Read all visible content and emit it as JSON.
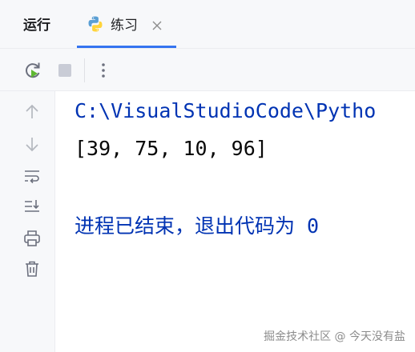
{
  "panel": {
    "title": "运行"
  },
  "tab": {
    "label": "练习",
    "icon": "python-icon",
    "close_icon": "close-icon"
  },
  "toolbar": {
    "buttons": [
      "rerun-icon",
      "stop-icon",
      "more-options-icon"
    ]
  },
  "gutter": {
    "buttons": [
      "up-arrow-icon",
      "down-arrow-icon",
      "soft-wrap-icon",
      "scroll-to-end-icon",
      "print-icon",
      "trash-icon"
    ]
  },
  "console": {
    "command_line": "C:\\VisualStudioCode\\Pytho",
    "output_line": "[39, 75, 10, 96]",
    "exit_message": "进程已结束，退出代码为 0"
  },
  "watermark": "掘金技术社区 @ 今天没有盐",
  "colors": {
    "accent": "#3574f0",
    "console_blue": "#0033b3",
    "rerun_green": "#5fb832"
  }
}
